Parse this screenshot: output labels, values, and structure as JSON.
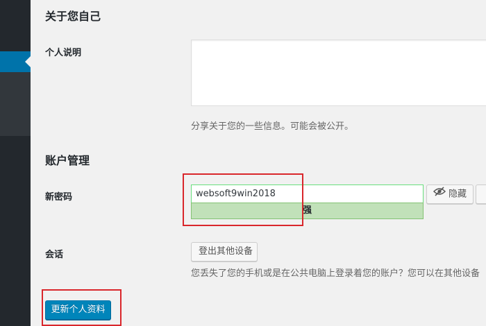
{
  "about_section": {
    "title": "关于您自己",
    "bio_label": "个人说明",
    "bio_value": "",
    "bio_description": "分享关于您的一些信息。可能会被公开。"
  },
  "account_section": {
    "title": "账户管理",
    "password_label": "新密码",
    "password_value": "websoft9win2018",
    "password_strength": "强",
    "hide_button_label": "隐藏",
    "sessions_label": "会话",
    "logout_button_label": "登出其他设备",
    "sessions_description": "您丢失了您的手机或是在公共电脑上登录着您的账户？您可以在其他设备"
  },
  "submit_button_label": "更新个人资料",
  "colors": {
    "primary_button": "#0085ba",
    "strength_strong_bg": "#c1e1b9",
    "annotation_red": "#d9262b",
    "sidebar_active": "#0073aa"
  },
  "icons": {
    "hide_button_icon": "eye-slash-icon"
  }
}
